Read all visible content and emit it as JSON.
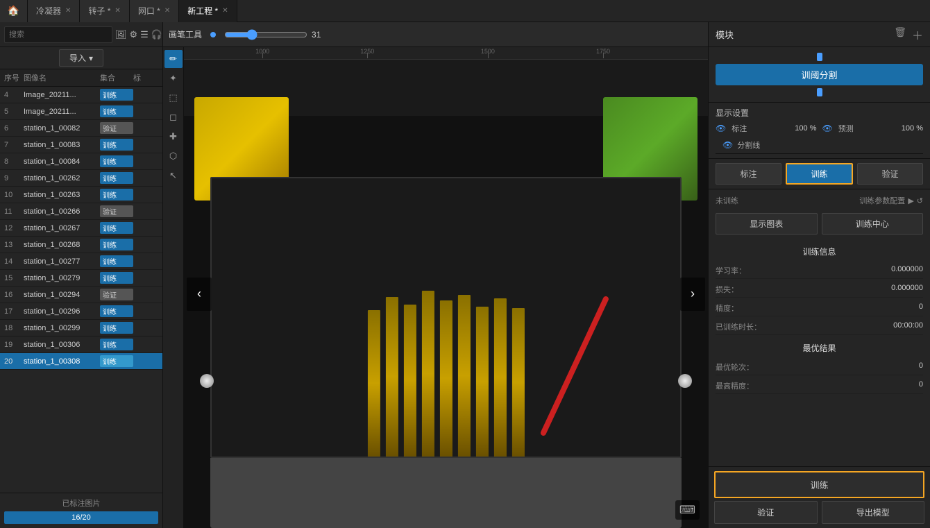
{
  "app": {
    "tabs": [
      {
        "id": "home",
        "label": "冷凝器",
        "active": false,
        "closable": true
      },
      {
        "id": "rotor",
        "label": "转子 *",
        "active": false,
        "closable": true
      },
      {
        "id": "network",
        "label": "网口 *",
        "active": false,
        "closable": true
      },
      {
        "id": "new-project",
        "label": "新工程 *",
        "active": true,
        "closable": true
      }
    ]
  },
  "toolbar": {
    "tool_label": "画笔工具",
    "slider_value": "31"
  },
  "sidebar": {
    "search_placeholder": "搜索",
    "import_label": "导入",
    "columns": {
      "num": "序号",
      "image": "图像名",
      "set": "集合",
      "mark": "标"
    },
    "rows": [
      {
        "num": 4,
        "name": "Image_20211...",
        "set": "训练",
        "mark": ""
      },
      {
        "num": 5,
        "name": "Image_20211...",
        "set": "训练",
        "mark": ""
      },
      {
        "num": 6,
        "name": "station_1_00082",
        "set": "验证",
        "mark": ""
      },
      {
        "num": 7,
        "name": "station_1_00083",
        "set": "训练",
        "mark": ""
      },
      {
        "num": 8,
        "name": "station_1_00084",
        "set": "训练",
        "mark": ""
      },
      {
        "num": 9,
        "name": "station_1_00262",
        "set": "训练",
        "mark": ""
      },
      {
        "num": 10,
        "name": "station_1_00263",
        "set": "训练",
        "mark": ""
      },
      {
        "num": 11,
        "name": "station_1_00266",
        "set": "验证",
        "mark": ""
      },
      {
        "num": 12,
        "name": "station_1_00267",
        "set": "训练",
        "mark": ""
      },
      {
        "num": 13,
        "name": "station_1_00268",
        "set": "训练",
        "mark": ""
      },
      {
        "num": 14,
        "name": "station_1_00277",
        "set": "训练",
        "mark": ""
      },
      {
        "num": 15,
        "name": "station_1_00279",
        "set": "训练",
        "mark": ""
      },
      {
        "num": 16,
        "name": "station_1_00294",
        "set": "验证",
        "mark": ""
      },
      {
        "num": 17,
        "name": "station_1_00296",
        "set": "训练",
        "mark": ""
      },
      {
        "num": 18,
        "name": "station_1_00299",
        "set": "训练",
        "mark": ""
      },
      {
        "num": 19,
        "name": "station_1_00306",
        "set": "训练",
        "mark": ""
      },
      {
        "num": 20,
        "name": "station_1_00308",
        "set": "训练",
        "mark": ""
      }
    ],
    "footer_label": "已标注图片",
    "progress": "16/20"
  },
  "right_panel": {
    "title": "模块",
    "threshold_btn": "训阈分割",
    "display_settings": {
      "title": "显示设置",
      "label_row": {
        "eye": "👁",
        "label": "标注",
        "value": "100 %"
      },
      "predict_row": {
        "eye": "👁",
        "label": "预测",
        "value": "100 %"
      },
      "seg_label": "分割线"
    },
    "tabs": {
      "label_btn": "标注",
      "train_btn": "训练",
      "verify_btn": "验证"
    },
    "training": {
      "status": "未训练",
      "config_label": "训练参数配置",
      "chart_btn": "显示图表",
      "center_btn": "训练中心",
      "info_title": "训练信息",
      "info_rows": [
        {
          "key": "学习率：",
          "value": "0.000000"
        },
        {
          "key": "损失：",
          "value": "0.000000"
        },
        {
          "key": "精度：",
          "value": "0"
        },
        {
          "key": "已训练时长：",
          "value": "00:00:00"
        }
      ],
      "best_title": "最优结果",
      "best_rows": [
        {
          "key": "最优轮次：",
          "value": "0"
        },
        {
          "key": "最高精度：",
          "value": "0"
        }
      ]
    },
    "actions": {
      "train_btn": "训练",
      "verify_btn": "验证",
      "export_btn": "导出模型"
    }
  }
}
